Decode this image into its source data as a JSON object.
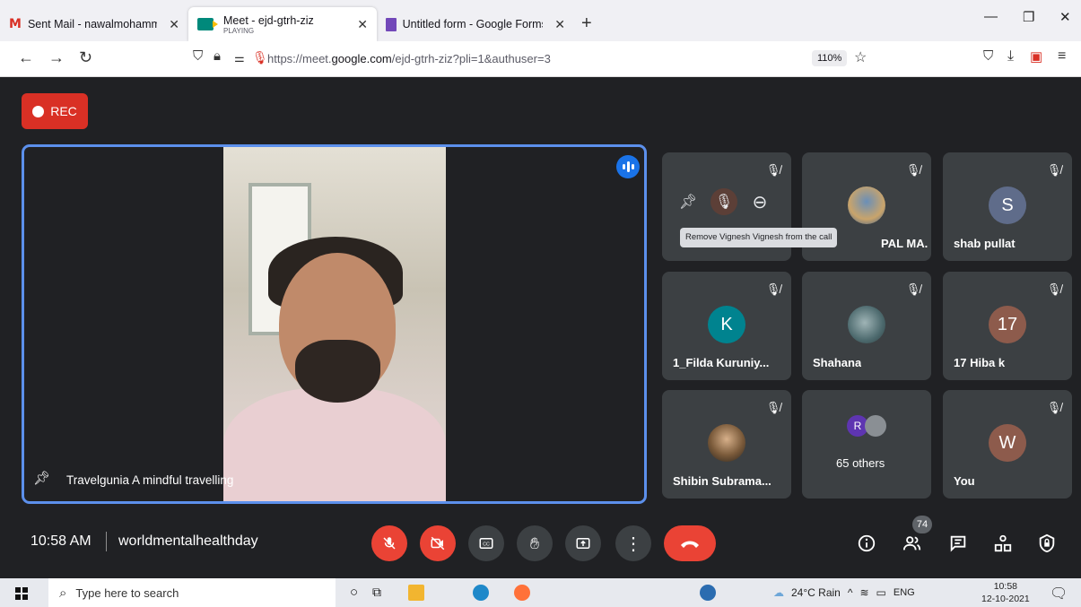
{
  "browser": {
    "tabs": [
      {
        "title": "Sent Mail - nawalmohammed@",
        "active": false
      },
      {
        "title": "Meet - ejd-gtrh-ziz",
        "subtitle": "PLAYING",
        "active": true
      },
      {
        "title": "Untitled form - Google Forms",
        "active": false
      }
    ],
    "url_prefix": "https://meet.",
    "url_domain": "google.com",
    "url_suffix": "/ejd-gtrh-ziz?pli=1&authuser=3",
    "zoom": "110%"
  },
  "meet": {
    "rec_label": "REC",
    "main_participant": "Travelgunia A mindful travelling",
    "tooltip": "Remove Vignesh Vignesh from the call",
    "participants": [
      {
        "name": "",
        "kind": "hover"
      },
      {
        "name": "PAL MA...",
        "kind": "photo"
      },
      {
        "name": "shab pullat",
        "initial": "S",
        "color": "#5f6c8a"
      },
      {
        "name": "1_Filda Kuruniy...",
        "initial": "K",
        "color": "#00838f"
      },
      {
        "name": "Shahana",
        "kind": "photo"
      },
      {
        "name": "17 Hiba k",
        "initial": "17",
        "color": "#8d5b4c"
      },
      {
        "name": "Shibin Subrama...",
        "kind": "photo"
      },
      {
        "name": "65 others",
        "initial": "R",
        "color": "#5e35b1"
      },
      {
        "name": "You",
        "initial": "W",
        "color": "#8d5b4c"
      }
    ],
    "time": "10:58 AM",
    "meeting_name": "worldmentalhealthday",
    "people_count": "74"
  },
  "taskbar": {
    "search_placeholder": "Type here to search",
    "weather": "24°C  Rain",
    "lang": "ENG",
    "clock_time": "10:58",
    "clock_date": "12-10-2021"
  }
}
